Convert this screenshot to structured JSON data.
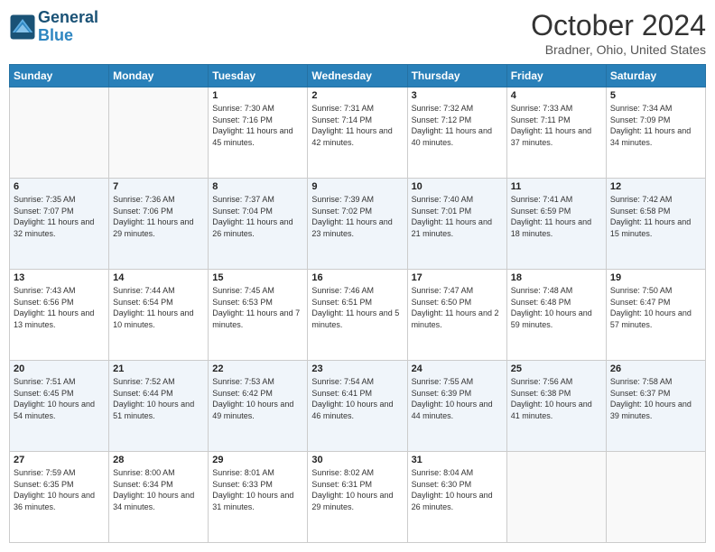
{
  "header": {
    "logo_line1": "General",
    "logo_line2": "Blue",
    "month": "October 2024",
    "location": "Bradner, Ohio, United States"
  },
  "days_of_week": [
    "Sunday",
    "Monday",
    "Tuesday",
    "Wednesday",
    "Thursday",
    "Friday",
    "Saturday"
  ],
  "weeks": [
    [
      {
        "day": "",
        "sunrise": "",
        "sunset": "",
        "daylight": ""
      },
      {
        "day": "",
        "sunrise": "",
        "sunset": "",
        "daylight": ""
      },
      {
        "day": "1",
        "sunrise": "Sunrise: 7:30 AM",
        "sunset": "Sunset: 7:16 PM",
        "daylight": "Daylight: 11 hours and 45 minutes."
      },
      {
        "day": "2",
        "sunrise": "Sunrise: 7:31 AM",
        "sunset": "Sunset: 7:14 PM",
        "daylight": "Daylight: 11 hours and 42 minutes."
      },
      {
        "day": "3",
        "sunrise": "Sunrise: 7:32 AM",
        "sunset": "Sunset: 7:12 PM",
        "daylight": "Daylight: 11 hours and 40 minutes."
      },
      {
        "day": "4",
        "sunrise": "Sunrise: 7:33 AM",
        "sunset": "Sunset: 7:11 PM",
        "daylight": "Daylight: 11 hours and 37 minutes."
      },
      {
        "day": "5",
        "sunrise": "Sunrise: 7:34 AM",
        "sunset": "Sunset: 7:09 PM",
        "daylight": "Daylight: 11 hours and 34 minutes."
      }
    ],
    [
      {
        "day": "6",
        "sunrise": "Sunrise: 7:35 AM",
        "sunset": "Sunset: 7:07 PM",
        "daylight": "Daylight: 11 hours and 32 minutes."
      },
      {
        "day": "7",
        "sunrise": "Sunrise: 7:36 AM",
        "sunset": "Sunset: 7:06 PM",
        "daylight": "Daylight: 11 hours and 29 minutes."
      },
      {
        "day": "8",
        "sunrise": "Sunrise: 7:37 AM",
        "sunset": "Sunset: 7:04 PM",
        "daylight": "Daylight: 11 hours and 26 minutes."
      },
      {
        "day": "9",
        "sunrise": "Sunrise: 7:39 AM",
        "sunset": "Sunset: 7:02 PM",
        "daylight": "Daylight: 11 hours and 23 minutes."
      },
      {
        "day": "10",
        "sunrise": "Sunrise: 7:40 AM",
        "sunset": "Sunset: 7:01 PM",
        "daylight": "Daylight: 11 hours and 21 minutes."
      },
      {
        "day": "11",
        "sunrise": "Sunrise: 7:41 AM",
        "sunset": "Sunset: 6:59 PM",
        "daylight": "Daylight: 11 hours and 18 minutes."
      },
      {
        "day": "12",
        "sunrise": "Sunrise: 7:42 AM",
        "sunset": "Sunset: 6:58 PM",
        "daylight": "Daylight: 11 hours and 15 minutes."
      }
    ],
    [
      {
        "day": "13",
        "sunrise": "Sunrise: 7:43 AM",
        "sunset": "Sunset: 6:56 PM",
        "daylight": "Daylight: 11 hours and 13 minutes."
      },
      {
        "day": "14",
        "sunrise": "Sunrise: 7:44 AM",
        "sunset": "Sunset: 6:54 PM",
        "daylight": "Daylight: 11 hours and 10 minutes."
      },
      {
        "day": "15",
        "sunrise": "Sunrise: 7:45 AM",
        "sunset": "Sunset: 6:53 PM",
        "daylight": "Daylight: 11 hours and 7 minutes."
      },
      {
        "day": "16",
        "sunrise": "Sunrise: 7:46 AM",
        "sunset": "Sunset: 6:51 PM",
        "daylight": "Daylight: 11 hours and 5 minutes."
      },
      {
        "day": "17",
        "sunrise": "Sunrise: 7:47 AM",
        "sunset": "Sunset: 6:50 PM",
        "daylight": "Daylight: 11 hours and 2 minutes."
      },
      {
        "day": "18",
        "sunrise": "Sunrise: 7:48 AM",
        "sunset": "Sunset: 6:48 PM",
        "daylight": "Daylight: 10 hours and 59 minutes."
      },
      {
        "day": "19",
        "sunrise": "Sunrise: 7:50 AM",
        "sunset": "Sunset: 6:47 PM",
        "daylight": "Daylight: 10 hours and 57 minutes."
      }
    ],
    [
      {
        "day": "20",
        "sunrise": "Sunrise: 7:51 AM",
        "sunset": "Sunset: 6:45 PM",
        "daylight": "Daylight: 10 hours and 54 minutes."
      },
      {
        "day": "21",
        "sunrise": "Sunrise: 7:52 AM",
        "sunset": "Sunset: 6:44 PM",
        "daylight": "Daylight: 10 hours and 51 minutes."
      },
      {
        "day": "22",
        "sunrise": "Sunrise: 7:53 AM",
        "sunset": "Sunset: 6:42 PM",
        "daylight": "Daylight: 10 hours and 49 minutes."
      },
      {
        "day": "23",
        "sunrise": "Sunrise: 7:54 AM",
        "sunset": "Sunset: 6:41 PM",
        "daylight": "Daylight: 10 hours and 46 minutes."
      },
      {
        "day": "24",
        "sunrise": "Sunrise: 7:55 AM",
        "sunset": "Sunset: 6:39 PM",
        "daylight": "Daylight: 10 hours and 44 minutes."
      },
      {
        "day": "25",
        "sunrise": "Sunrise: 7:56 AM",
        "sunset": "Sunset: 6:38 PM",
        "daylight": "Daylight: 10 hours and 41 minutes."
      },
      {
        "day": "26",
        "sunrise": "Sunrise: 7:58 AM",
        "sunset": "Sunset: 6:37 PM",
        "daylight": "Daylight: 10 hours and 39 minutes."
      }
    ],
    [
      {
        "day": "27",
        "sunrise": "Sunrise: 7:59 AM",
        "sunset": "Sunset: 6:35 PM",
        "daylight": "Daylight: 10 hours and 36 minutes."
      },
      {
        "day": "28",
        "sunrise": "Sunrise: 8:00 AM",
        "sunset": "Sunset: 6:34 PM",
        "daylight": "Daylight: 10 hours and 34 minutes."
      },
      {
        "day": "29",
        "sunrise": "Sunrise: 8:01 AM",
        "sunset": "Sunset: 6:33 PM",
        "daylight": "Daylight: 10 hours and 31 minutes."
      },
      {
        "day": "30",
        "sunrise": "Sunrise: 8:02 AM",
        "sunset": "Sunset: 6:31 PM",
        "daylight": "Daylight: 10 hours and 29 minutes."
      },
      {
        "day": "31",
        "sunrise": "Sunrise: 8:04 AM",
        "sunset": "Sunset: 6:30 PM",
        "daylight": "Daylight: 10 hours and 26 minutes."
      },
      {
        "day": "",
        "sunrise": "",
        "sunset": "",
        "daylight": ""
      },
      {
        "day": "",
        "sunrise": "",
        "sunset": "",
        "daylight": ""
      }
    ]
  ]
}
